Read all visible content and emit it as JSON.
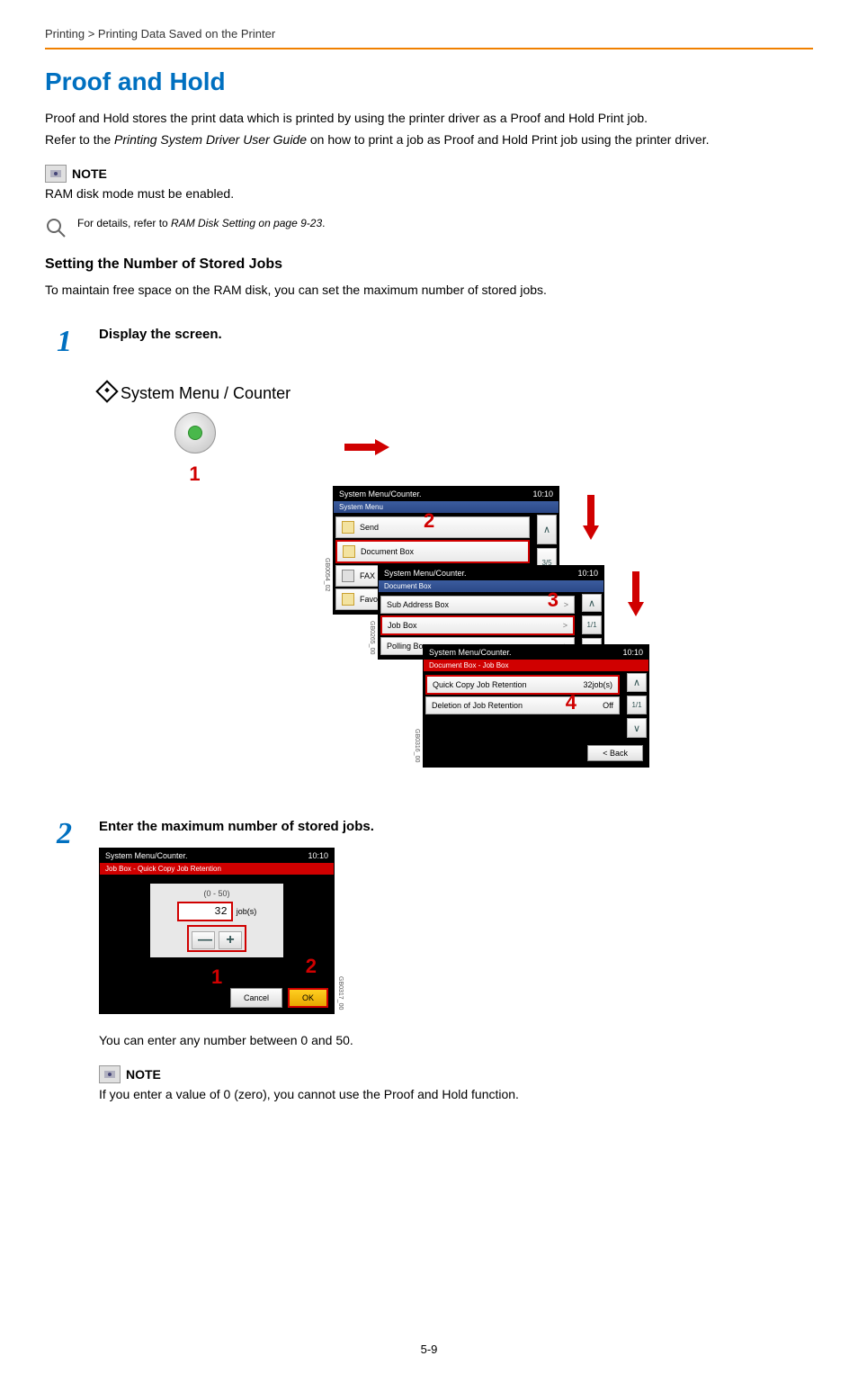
{
  "breadcrumb": "Printing > Printing Data Saved on the Printer",
  "h1": "Proof and Hold",
  "intro1": "Proof and Hold stores the print data which is printed by using the printer driver as a Proof and Hold Print job.",
  "intro2_a": "Refer to the ",
  "intro2_i": "Printing System Driver User Guide",
  "intro2_b": " on how to print a job as Proof and Hold Print job using the printer driver.",
  "note1": {
    "title": "NOTE",
    "text": "RAM disk mode must be enabled."
  },
  "details_a": "For details, refer to ",
  "details_i": "RAM Disk Setting on page 9-23",
  "details_b": ".",
  "subheading": "Setting the Number of Stored Jobs",
  "subtext": "To maintain free space on the RAM disk, you can set the maximum number of stored jobs.",
  "step1": {
    "num": "1",
    "title": "Display the screen.",
    "hw_label": "System Menu / Counter",
    "hw_callout": "1",
    "screen1": {
      "header": "System Menu/Counter.",
      "time": "10:10",
      "sub": "System Menu",
      "items": [
        "Send",
        "Document Box",
        "FAX",
        "Favorites"
      ],
      "callout": "2",
      "pager": "3/5",
      "code": "GB0054_02"
    },
    "screen2": {
      "header": "System Menu/Counter.",
      "time": "10:10",
      "sub": "Document Box",
      "items": [
        "Sub Address Box",
        "Job Box",
        "Polling Box"
      ],
      "callout": "3",
      "pager": "1/1",
      "code": "GB0265_00"
    },
    "screen3": {
      "header": "System Menu/Counter.",
      "time": "10:10",
      "sub": "Document Box - Job Box",
      "rows": [
        {
          "label": "Quick Copy Job Retention",
          "value": "32job(s)"
        },
        {
          "label": "Deletion of Job Retention",
          "value": "Off"
        }
      ],
      "callout": "4",
      "pager": "1/1",
      "back": "< Back",
      "code": "GB0316_00"
    }
  },
  "step2": {
    "num": "2",
    "title": "Enter the maximum number of stored jobs.",
    "panel": {
      "header": "System Menu/Counter.",
      "time": "10:10",
      "sub": "Job Box - Quick Copy Job Retention",
      "range": "(0 - 50)",
      "value": "32",
      "unit": "job(s)",
      "minus": "—",
      "plus": "+",
      "cancel": "Cancel",
      "ok": "OK",
      "callout1": "1",
      "callout2": "2",
      "code": "GB0317_00"
    },
    "after": "You can enter any number between 0 and 50.",
    "note": {
      "title": "NOTE",
      "text": "If you enter a value of 0 (zero), you cannot use the Proof and Hold function."
    }
  },
  "page_num": "5-9"
}
